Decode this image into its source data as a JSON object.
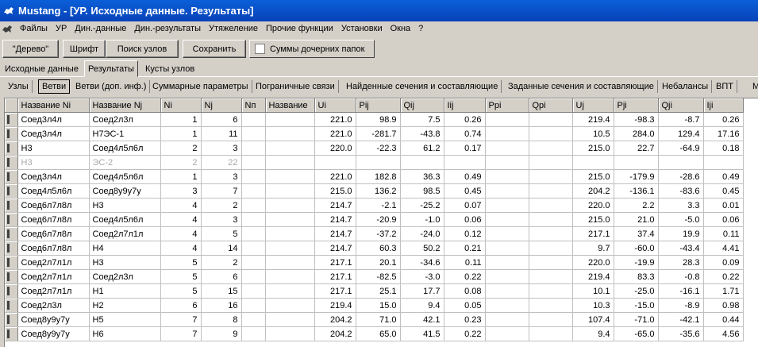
{
  "window": {
    "title": "Mustang - [УР. Исходные данные. Результаты]"
  },
  "menu": [
    "Файлы",
    "УР",
    "Дин.-данные",
    "Дин.-результаты",
    "Утяжеление",
    "Прочие функции",
    "Установки",
    "Окна",
    "?"
  ],
  "toolbar": {
    "tree_label": "\"Дерево\"",
    "font_label": "Шрифт",
    "search_label": "Поиск узлов",
    "save_label": "Сохранить",
    "sums_label": "Суммы дочерних папок",
    "sums_checked": false
  },
  "tabs_top": [
    "Исходные данные",
    "Результаты",
    "Кусты узлов"
  ],
  "tabs_top_active": "Результаты",
  "tabs_sub": [
    "Узлы",
    "Ветви",
    "Ветви (доп. инф.)",
    "Суммарные параметры",
    "Пограничные связи",
    "Найденные сечения и составляющие",
    "Заданные сечения и составляющие",
    "Небалансы",
    "ВПТ",
    "М"
  ],
  "tabs_sub_active": "Ветви",
  "grid": {
    "columns": [
      "Название Ni",
      "Название Nj",
      "Ni",
      "Nj",
      "Nп",
      "Название",
      "Ui",
      "Pij",
      "Qij",
      "Iij",
      "Ppi",
      "Qpi",
      "Uj",
      "Pji",
      "Qji",
      "Iji"
    ],
    "rows": [
      [
        "Соед3л4л",
        "Соед2л3л",
        "1",
        "6",
        "",
        "",
        "221.0",
        "98.9",
        "7.5",
        "0.26",
        "",
        "",
        "219.4",
        "-98.3",
        "-8.7",
        "0.26"
      ],
      [
        "Соед3л4л",
        "Н7ЭС-1",
        "1",
        "11",
        "",
        "",
        "221.0",
        "-281.7",
        "-43.8",
        "0.74",
        "",
        "",
        "10.5",
        "284.0",
        "129.4",
        "17.16"
      ],
      [
        "Н3",
        "Соед4л5л6л",
        "2",
        "3",
        "",
        "",
        "220.0",
        "-22.3",
        "61.2",
        "0.17",
        "",
        "",
        "215.0",
        "22.7",
        "-64.9",
        "0.18"
      ],
      [
        "Н3",
        "ЭС-2",
        "2",
        "22",
        "",
        "",
        "",
        "",
        "",
        "",
        "",
        "",
        "",
        "",
        "",
        ""
      ],
      [
        "Соед3л4л",
        "Соед4л5л6л",
        "1",
        "3",
        "",
        "",
        "221.0",
        "182.8",
        "36.3",
        "0.49",
        "",
        "",
        "215.0",
        "-179.9",
        "-28.6",
        "0.49"
      ],
      [
        "Соед4л5л6л",
        "Соед8у9у7у",
        "3",
        "7",
        "",
        "",
        "215.0",
        "136.2",
        "98.5",
        "0.45",
        "",
        "",
        "204.2",
        "-136.1",
        "-83.6",
        "0.45"
      ],
      [
        "Соед6л7л8л",
        "Н3",
        "4",
        "2",
        "",
        "",
        "214.7",
        "-2.1",
        "-25.2",
        "0.07",
        "",
        "",
        "220.0",
        "2.2",
        "3.3",
        "0.01"
      ],
      [
        "Соед6л7л8л",
        "Соед4л5л6л",
        "4",
        "3",
        "",
        "",
        "214.7",
        "-20.9",
        "-1.0",
        "0.06",
        "",
        "",
        "215.0",
        "21.0",
        "-5.0",
        "0.06"
      ],
      [
        "Соед6л7л8л",
        "Соед2л7л1л",
        "4",
        "5",
        "",
        "",
        "214.7",
        "-37.2",
        "-24.0",
        "0.12",
        "",
        "",
        "217.1",
        "37.4",
        "19.9",
        "0.11"
      ],
      [
        "Соед6л7л8л",
        "Н4",
        "4",
        "14",
        "",
        "",
        "214.7",
        "60.3",
        "50.2",
        "0.21",
        "",
        "",
        "9.7",
        "-60.0",
        "-43.4",
        "4.41"
      ],
      [
        "Соед2л7л1л",
        "Н3",
        "5",
        "2",
        "",
        "",
        "217.1",
        "20.1",
        "-34.6",
        "0.11",
        "",
        "",
        "220.0",
        "-19.9",
        "28.3",
        "0.09"
      ],
      [
        "Соед2л7л1л",
        "Соед2л3л",
        "5",
        "6",
        "",
        "",
        "217.1",
        "-82.5",
        "-3.0",
        "0.22",
        "",
        "",
        "219.4",
        "83.3",
        "-0.8",
        "0.22"
      ],
      [
        "Соед2л7л1л",
        "Н1",
        "5",
        "15",
        "",
        "",
        "217.1",
        "25.1",
        "17.7",
        "0.08",
        "",
        "",
        "10.1",
        "-25.0",
        "-16.1",
        "1.71"
      ],
      [
        "Соед2л3л",
        "Н2",
        "6",
        "16",
        "",
        "",
        "219.4",
        "15.0",
        "9.4",
        "0.05",
        "",
        "",
        "10.3",
        "-15.0",
        "-8.9",
        "0.98"
      ],
      [
        "Соед8у9у7у",
        "Н5",
        "7",
        "8",
        "",
        "",
        "204.2",
        "71.0",
        "42.1",
        "0.23",
        "",
        "",
        "107.4",
        "-71.0",
        "-42.1",
        "0.44"
      ],
      [
        "Соед8у9у7у",
        "Н6",
        "7",
        "9",
        "",
        "",
        "204.2",
        "65.0",
        "41.5",
        "0.22",
        "",
        "",
        "9.4",
        "-65.0",
        "-35.6",
        "4.56"
      ]
    ],
    "dim_rows": [
      3
    ]
  }
}
